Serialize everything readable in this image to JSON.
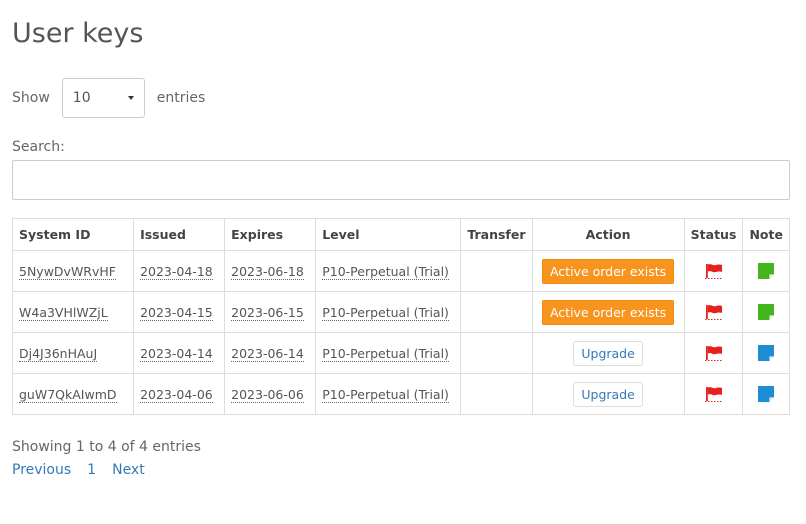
{
  "page": {
    "title": "User keys"
  },
  "length": {
    "show_label": "Show",
    "value": "10",
    "entries_label": "entries"
  },
  "search": {
    "label": "Search:",
    "value": ""
  },
  "table": {
    "headers": [
      "System ID",
      "Issued",
      "Expires",
      "Level",
      "Transfer",
      "Action",
      "Status",
      "Note"
    ],
    "rows": [
      {
        "system_id": "5NywDvWRvHF",
        "issued": "2023-04-18",
        "expires": "2023-06-18",
        "level": "P10-Perpetual (Trial)",
        "transfer": "",
        "action": "Active order exists",
        "action_type": "active",
        "status": "flag-icon",
        "note_color": "#44b51d"
      },
      {
        "system_id": "W4a3VHlWZjL",
        "issued": "2023-04-15",
        "expires": "2023-06-15",
        "level": "P10-Perpetual (Trial)",
        "transfer": "",
        "action": "Active order exists",
        "action_type": "active",
        "status": "flag-icon",
        "note_color": "#44b51d"
      },
      {
        "system_id": "Dj4J36nHAuJ",
        "issued": "2023-04-14",
        "expires": "2023-06-14",
        "level": "P10-Perpetual (Trial)",
        "transfer": "",
        "action": "Upgrade",
        "action_type": "upgrade",
        "status": "flag-icon",
        "note_color": "#1f8dd6"
      },
      {
        "system_id": "guW7QkAIwmD",
        "issued": "2023-04-06",
        "expires": "2023-06-06",
        "level": "P10-Perpetual (Trial)",
        "transfer": "",
        "action": "Upgrade",
        "action_type": "upgrade",
        "status": "flag-icon",
        "note_color": "#1f8dd6"
      }
    ]
  },
  "footer": {
    "info": "Showing 1 to 4 of 4 entries",
    "prev": "Previous",
    "page": "1",
    "next": "Next"
  },
  "colors": {
    "flag": "#e8201d",
    "action_orange": "#f7941d",
    "link": "#337ab7"
  }
}
